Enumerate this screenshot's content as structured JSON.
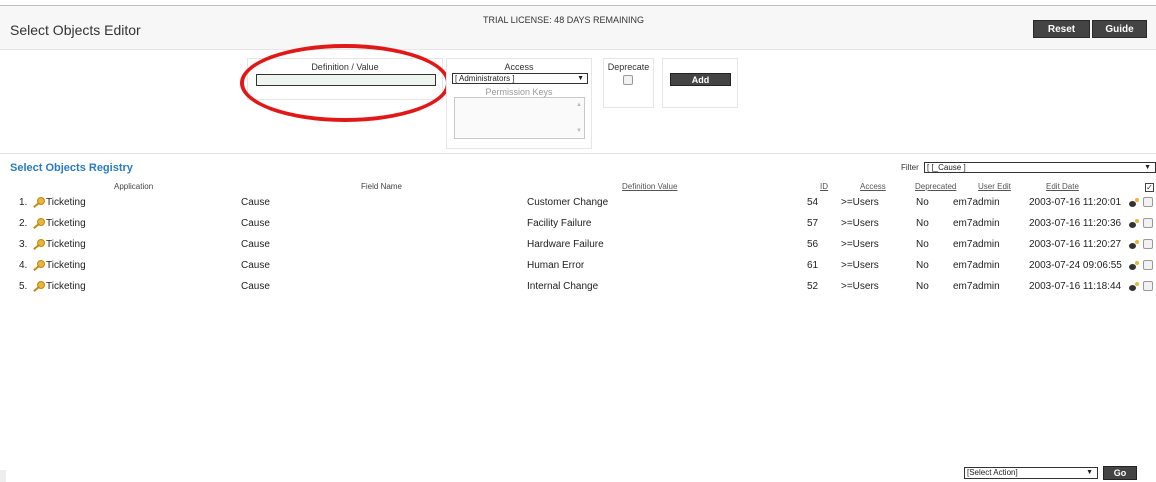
{
  "header": {
    "title": "Select Objects Editor",
    "license": "TRIAL LICENSE: 48 DAYS REMAINING",
    "reset_label": "Reset",
    "guide_label": "Guide"
  },
  "form": {
    "definition_label": "Definition / Value",
    "definition_value": "",
    "access_label": "Access",
    "access_value": "[ Administrators ]",
    "permission_keys_label": "Permission Keys",
    "deprecate_label": "Deprecate",
    "add_label": "Add"
  },
  "registry": {
    "title": "Select Objects Registry",
    "filter_label": "Filter",
    "filter_value": "[ [_Cause ]",
    "columns": {
      "application": "Application",
      "field_name": "Field Name",
      "definition_value": "Definition Value",
      "id": "ID",
      "access": "Access",
      "deprecated": "Deprecated",
      "user_edit": "User Edit",
      "edit_date": "Edit Date"
    },
    "rows": [
      {
        "num": "1.",
        "application": "Ticketing",
        "field_name": "Cause",
        "definition_value": "Customer Change",
        "id": "54",
        "access": ">=Users",
        "deprecated": "No",
        "user_edit": "em7admin",
        "edit_date": "2003-07-16 11:20:01"
      },
      {
        "num": "2.",
        "application": "Ticketing",
        "field_name": "Cause",
        "definition_value": "Facility Failure",
        "id": "57",
        "access": ">=Users",
        "deprecated": "No",
        "user_edit": "em7admin",
        "edit_date": "2003-07-16 11:20:36"
      },
      {
        "num": "3.",
        "application": "Ticketing",
        "field_name": "Cause",
        "definition_value": "Hardware Failure",
        "id": "56",
        "access": ">=Users",
        "deprecated": "No",
        "user_edit": "em7admin",
        "edit_date": "2003-07-16 11:20:27"
      },
      {
        "num": "4.",
        "application": "Ticketing",
        "field_name": "Cause",
        "definition_value": "Human Error",
        "id": "61",
        "access": ">=Users",
        "deprecated": "No",
        "user_edit": "em7admin",
        "edit_date": "2003-07-24 09:06:55"
      },
      {
        "num": "5.",
        "application": "Ticketing",
        "field_name": "Cause",
        "definition_value": "Internal Change",
        "id": "52",
        "access": ">=Users",
        "deprecated": "No",
        "user_edit": "em7admin",
        "edit_date": "2003-07-16 11:18:44"
      }
    ]
  },
  "footer": {
    "action_value": "[Select Action]",
    "go_label": "Go"
  },
  "icons": {
    "row_icon": "key-icon",
    "edit_icon": "edit-icon",
    "annotation": "red-circle-annotation"
  },
  "colors": {
    "registry_title": "#2a7bc1",
    "annotation": "#e01818",
    "button": "#444444"
  }
}
